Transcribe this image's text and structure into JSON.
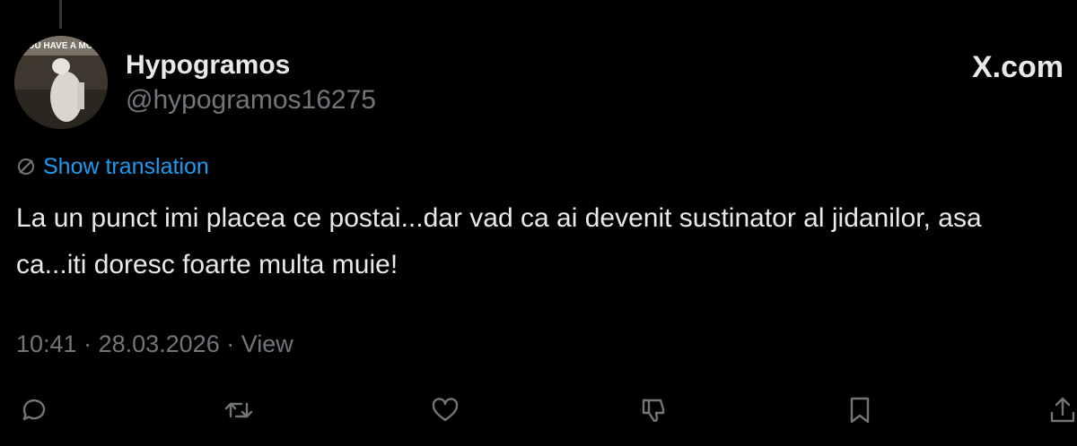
{
  "tweet": {
    "author_name": "Hypogramos",
    "author_handle": "@hypogramos16275",
    "brand": "X.com",
    "avatar_caption": "YOU HAVE A MO...",
    "translate_label": "Show translation",
    "text": "La un punct imi placea ce postai...dar vad ca ai devenit sustinator al jidanilor, asa ca...iti doresc foarte multa muie!",
    "time": "10:41",
    "date": "28.03.2026",
    "view_label": "View",
    "separator": " · "
  },
  "actions": [
    "reply-icon",
    "retweet-icon",
    "like-icon",
    "dislike-icon",
    "bookmark-icon",
    "share-icon"
  ],
  "colors": {
    "background": "#000000",
    "text": "#e7e9ea",
    "muted": "#71767b",
    "link": "#1d9bf0"
  }
}
